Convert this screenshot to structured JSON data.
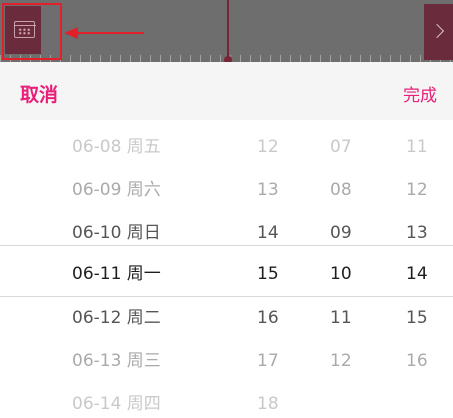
{
  "topbar": {
    "calendar_icon": "calendar-icon",
    "next_icon": "chevron-right-icon",
    "accent_color": "#e0202a"
  },
  "actionbar": {
    "cancel_label": "取消",
    "done_label": "完成",
    "accent_color": "#e9207a"
  },
  "picker": {
    "selected_index": 3,
    "rows": [
      {
        "date": "06-08 周五",
        "col1": "12",
        "col2": "07",
        "col3": "11"
      },
      {
        "date": "06-09 周六",
        "col1": "13",
        "col2": "08",
        "col3": "12"
      },
      {
        "date": "06-10 周日",
        "col1": "14",
        "col2": "09",
        "col3": "13"
      },
      {
        "date": "06-11 周一",
        "col1": "15",
        "col2": "10",
        "col3": "14"
      },
      {
        "date": "06-12 周二",
        "col1": "16",
        "col2": "11",
        "col3": "15"
      },
      {
        "date": "06-13 周三",
        "col1": "17",
        "col2": "12",
        "col3": "16"
      },
      {
        "date": "06-14 周四",
        "col1": "18",
        "col2": "",
        "col3": ""
      }
    ]
  }
}
